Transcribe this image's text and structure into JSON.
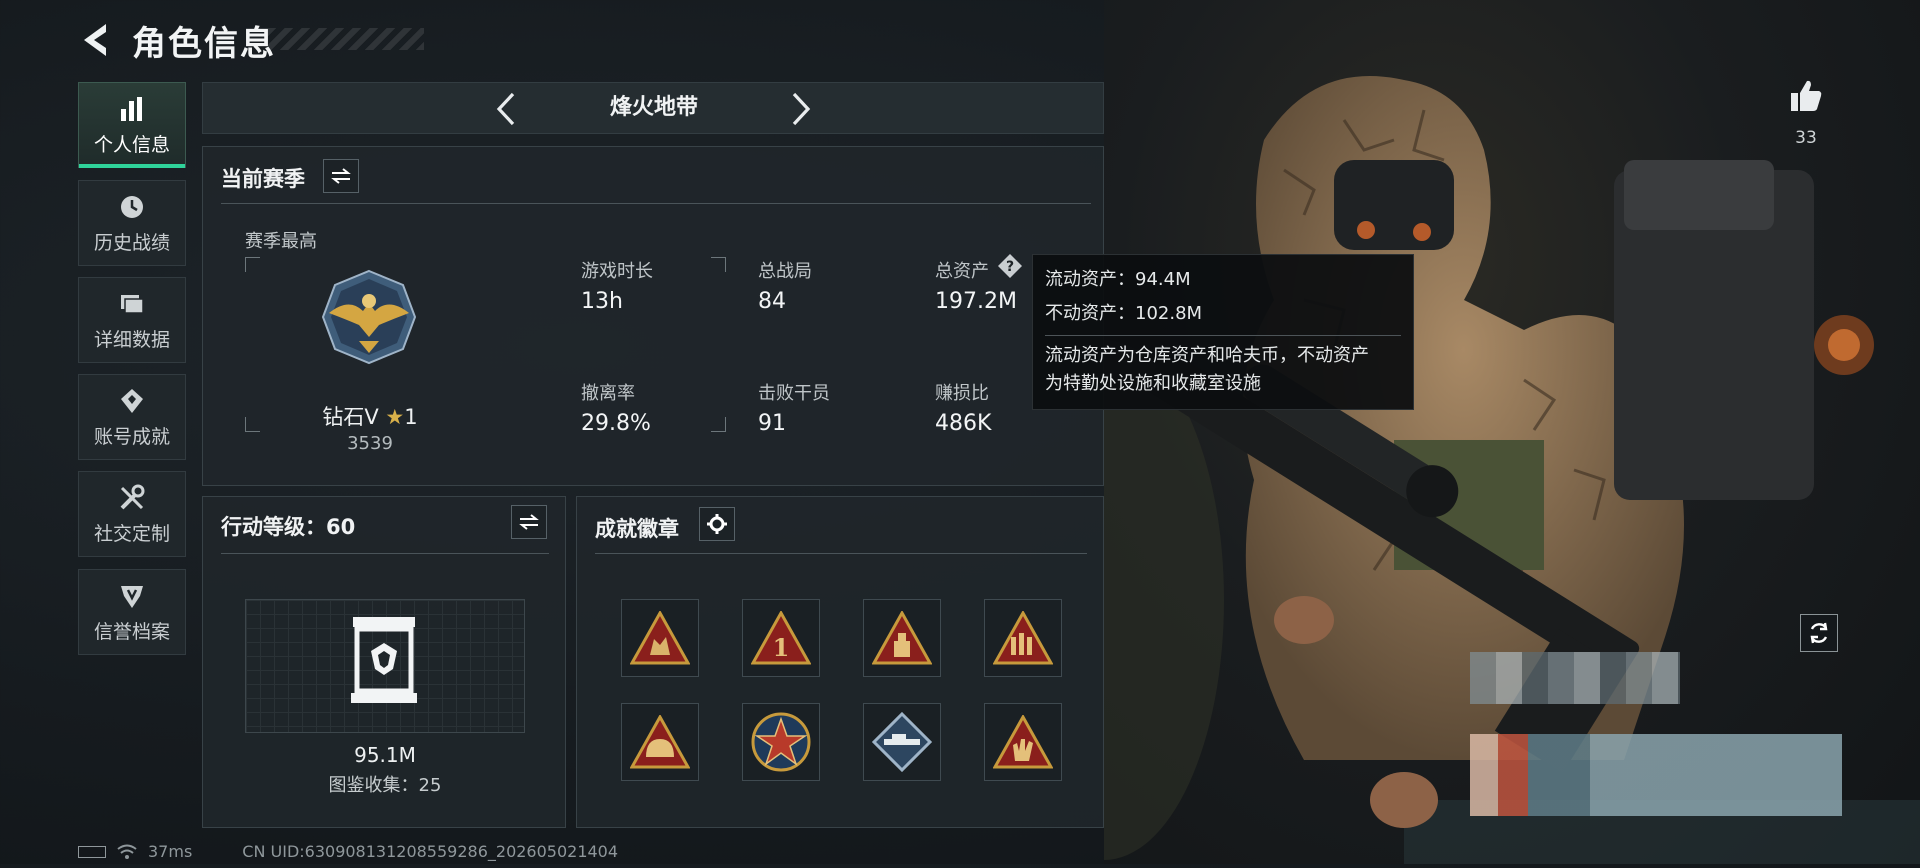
{
  "header": {
    "title": "角色信息"
  },
  "sidebar": {
    "items": [
      {
        "label": "个人信息",
        "icon": "bar-chart-icon",
        "active": true
      },
      {
        "label": "历史战绩",
        "icon": "clock-icon",
        "active": false
      },
      {
        "label": "详细数据",
        "icon": "folder-icon",
        "active": false
      },
      {
        "label": "账号成就",
        "icon": "achievement-icon",
        "active": false
      },
      {
        "label": "社交定制",
        "icon": "tools-icon",
        "active": false
      },
      {
        "label": "信誉档案",
        "icon": "shield-icon",
        "active": false
      }
    ]
  },
  "mode": {
    "title": "烽火地带"
  },
  "season": {
    "title": "当前赛季",
    "best_label": "赛季最高",
    "rank_name": "钻石V",
    "rank_stars": "1",
    "rank_points": "3539",
    "stats": [
      {
        "label": "游戏时长",
        "value": "13h"
      },
      {
        "label": "总战局",
        "value": "84"
      },
      {
        "label": "总资产",
        "value": "197.2M"
      },
      {
        "label": "撤离率",
        "value": "29.8%"
      },
      {
        "label": "击败干员",
        "value": "91"
      },
      {
        "label": "赚损比",
        "value": "486K"
      }
    ]
  },
  "tooltip": {
    "line1": "流动资产：94.4M",
    "line2": "不动资产：102.8M",
    "desc1": "流动资产为仓库资产和哈夫币，不动资产",
    "desc2": "为特勤处设施和收藏室设施"
  },
  "action_level": {
    "title": "行动等级：60",
    "value": "95.1M",
    "collection": "图鉴收集：25"
  },
  "achievements": {
    "title": "成就徽章",
    "badges": [
      "soldiers-badge",
      "number-one-badge",
      "medkit-badge",
      "ammo-badge",
      "helmet-badge",
      "star-emblem-badge",
      "rifle-badge",
      "hand-sign-badge"
    ]
  },
  "right_panel": {
    "likes": "33"
  },
  "status_bar": {
    "ping": "37ms",
    "uid": "CN UID:630908131208559286_202605021404"
  },
  "colors": {
    "accent": "#2fd39a",
    "panel": "#1f262a",
    "gold": "#c79a3c",
    "badge_red": "#8a1f1c"
  }
}
